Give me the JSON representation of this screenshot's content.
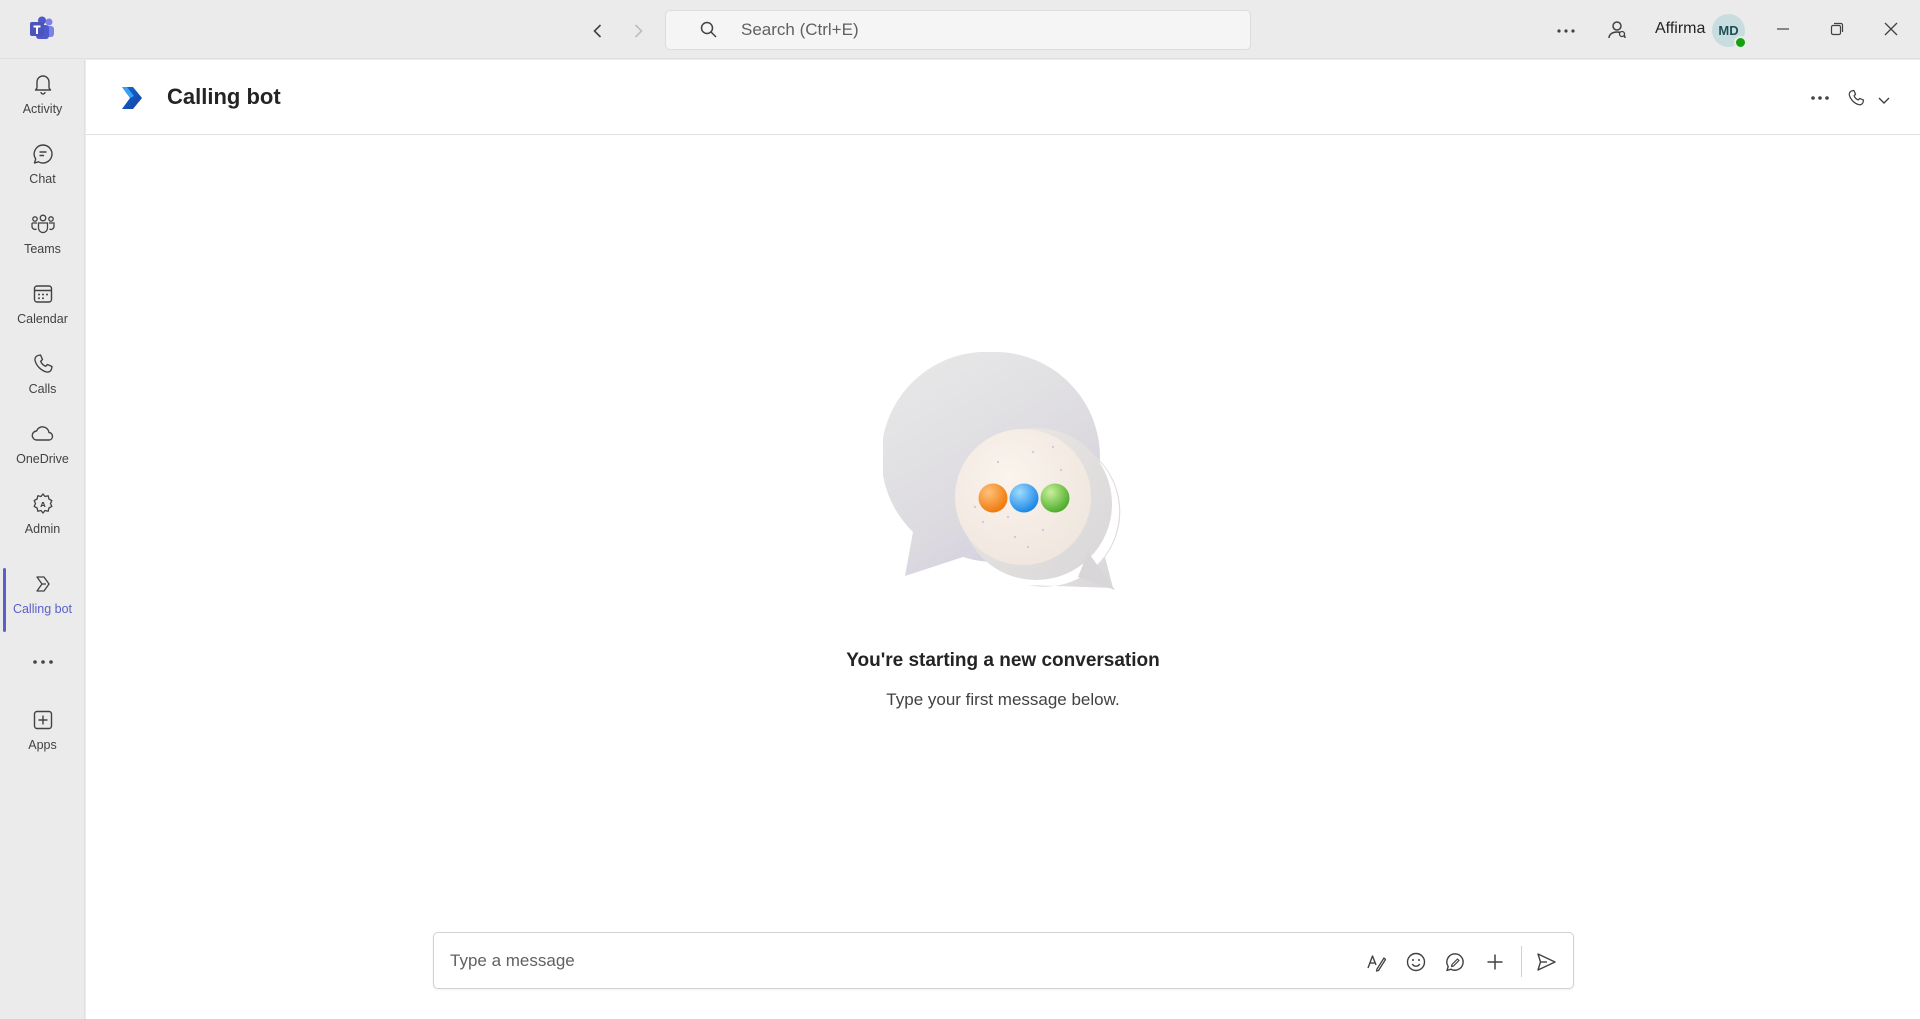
{
  "titlebar": {
    "search_placeholder": "Search (Ctrl+E)",
    "org_name": "Affirma",
    "avatar_initials": "MD"
  },
  "rail": {
    "items": [
      {
        "label": "Activity",
        "icon": "bell-icon"
      },
      {
        "label": "Chat",
        "icon": "chat-icon"
      },
      {
        "label": "Teams",
        "icon": "teams-icon"
      },
      {
        "label": "Calendar",
        "icon": "calendar-icon"
      },
      {
        "label": "Calls",
        "icon": "phone-icon"
      },
      {
        "label": "OneDrive",
        "icon": "cloud-icon"
      },
      {
        "label": "Admin",
        "icon": "admin-gear-icon"
      },
      {
        "label": "Calling bot",
        "icon": "bot-icon",
        "active": true
      },
      {
        "label": "Apps",
        "icon": "plus-box-icon"
      }
    ]
  },
  "header": {
    "title": "Calling bot"
  },
  "empty_state": {
    "title": "You're starting a new conversation",
    "subtitle": "Type your first message below."
  },
  "composer": {
    "placeholder": "Type a message"
  },
  "colors": {
    "accent": "#5b5fc7",
    "presence_available": "#13a10e",
    "bubble_orange": "#f7891f",
    "bubble_blue": "#2b9cf2",
    "bubble_green": "#6cc04a"
  }
}
